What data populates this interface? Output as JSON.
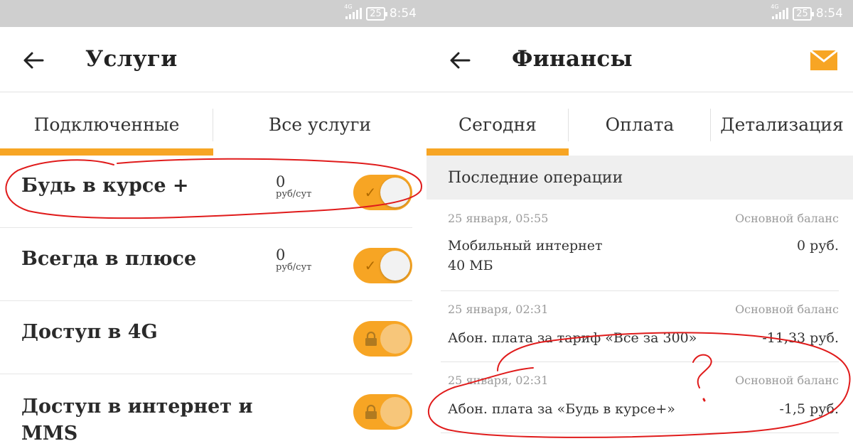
{
  "status": {
    "network": "4G",
    "battery": "25",
    "time": "8:54"
  },
  "left": {
    "title": "Услуги",
    "tabs": [
      {
        "label": "Подключенные",
        "active": true
      },
      {
        "label": "Все услуги",
        "active": false
      }
    ],
    "services": [
      {
        "name": "Будь в курсе +",
        "price": "0",
        "unit": "руб/сут",
        "state": "on"
      },
      {
        "name": "Всегда в плюсе",
        "price": "0",
        "unit": "руб/сут",
        "state": "on"
      },
      {
        "name": "Доступ в 4G",
        "state": "locked"
      },
      {
        "name": "Доступ в интернет и MMS",
        "state": "locked"
      }
    ]
  },
  "right": {
    "title": "Финансы",
    "tabs": [
      {
        "label": "Сегодня",
        "active": true
      },
      {
        "label": "Оплата",
        "active": false
      },
      {
        "label": "Детализация",
        "active": false
      }
    ],
    "section_title": "Последние операции",
    "operations": [
      {
        "date": "25 января, 05:55",
        "balance": "Основной баланс",
        "description": "Мобильный интернет\n40 МБ",
        "amount": "0 руб."
      },
      {
        "date": "25 января, 02:31",
        "balance": "Основной баланс",
        "description": "Абон. плата за тариф «Все за 300»",
        "amount": "-11,33 руб."
      },
      {
        "date": "25 января, 02:31",
        "balance": "Основной баланс",
        "description": "Абон. плата за «Будь в курсе+»",
        "amount": "-1,5 руб."
      }
    ]
  },
  "colors": {
    "accent": "#f7a524",
    "annotation": "#e01b1b",
    "statusbar": "#cfcfcf"
  },
  "icons": {
    "back": "arrow-left-icon",
    "mail": "envelope-icon",
    "check": "check-icon",
    "lock": "lock-icon"
  }
}
